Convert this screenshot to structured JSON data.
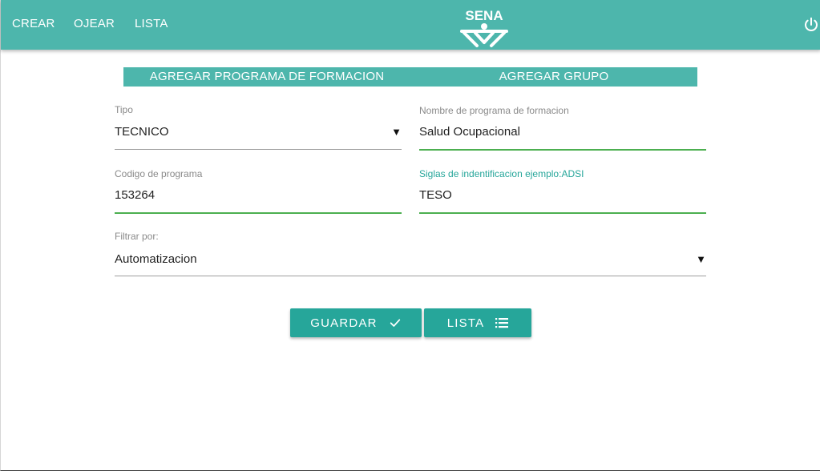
{
  "nav": {
    "items": [
      {
        "label": "CREAR"
      },
      {
        "label": "OJEAR"
      },
      {
        "label": "LISTA"
      }
    ],
    "logo_text": "SENA",
    "power_icon": "power-icon"
  },
  "tabs": [
    {
      "label": "AGREGAR PROGRAMA DE FORMACION"
    },
    {
      "label": "AGREGAR GRUPO"
    }
  ],
  "form": {
    "tipo": {
      "label": "Tipo",
      "value": "TECNICO"
    },
    "nombre": {
      "label": "Nombre de programa de formacion",
      "value": "Salud Ocupacional"
    },
    "codigo": {
      "label": "Codigo de programa",
      "value": "153264"
    },
    "siglas": {
      "label": "Siglas de indentificacion ejemplo:ADSI",
      "value": "TESO"
    },
    "filtrar": {
      "label": "Filtrar por:",
      "value": "Automatizacion"
    }
  },
  "actions": {
    "guardar": {
      "label": "GUARDAR",
      "icon": "check-icon"
    },
    "lista": {
      "label": "LISTA",
      "icon": "list-icon"
    }
  },
  "colors": {
    "primary": "#4db6ac",
    "button": "#26a69a",
    "valid_underline": "#4caf50"
  }
}
